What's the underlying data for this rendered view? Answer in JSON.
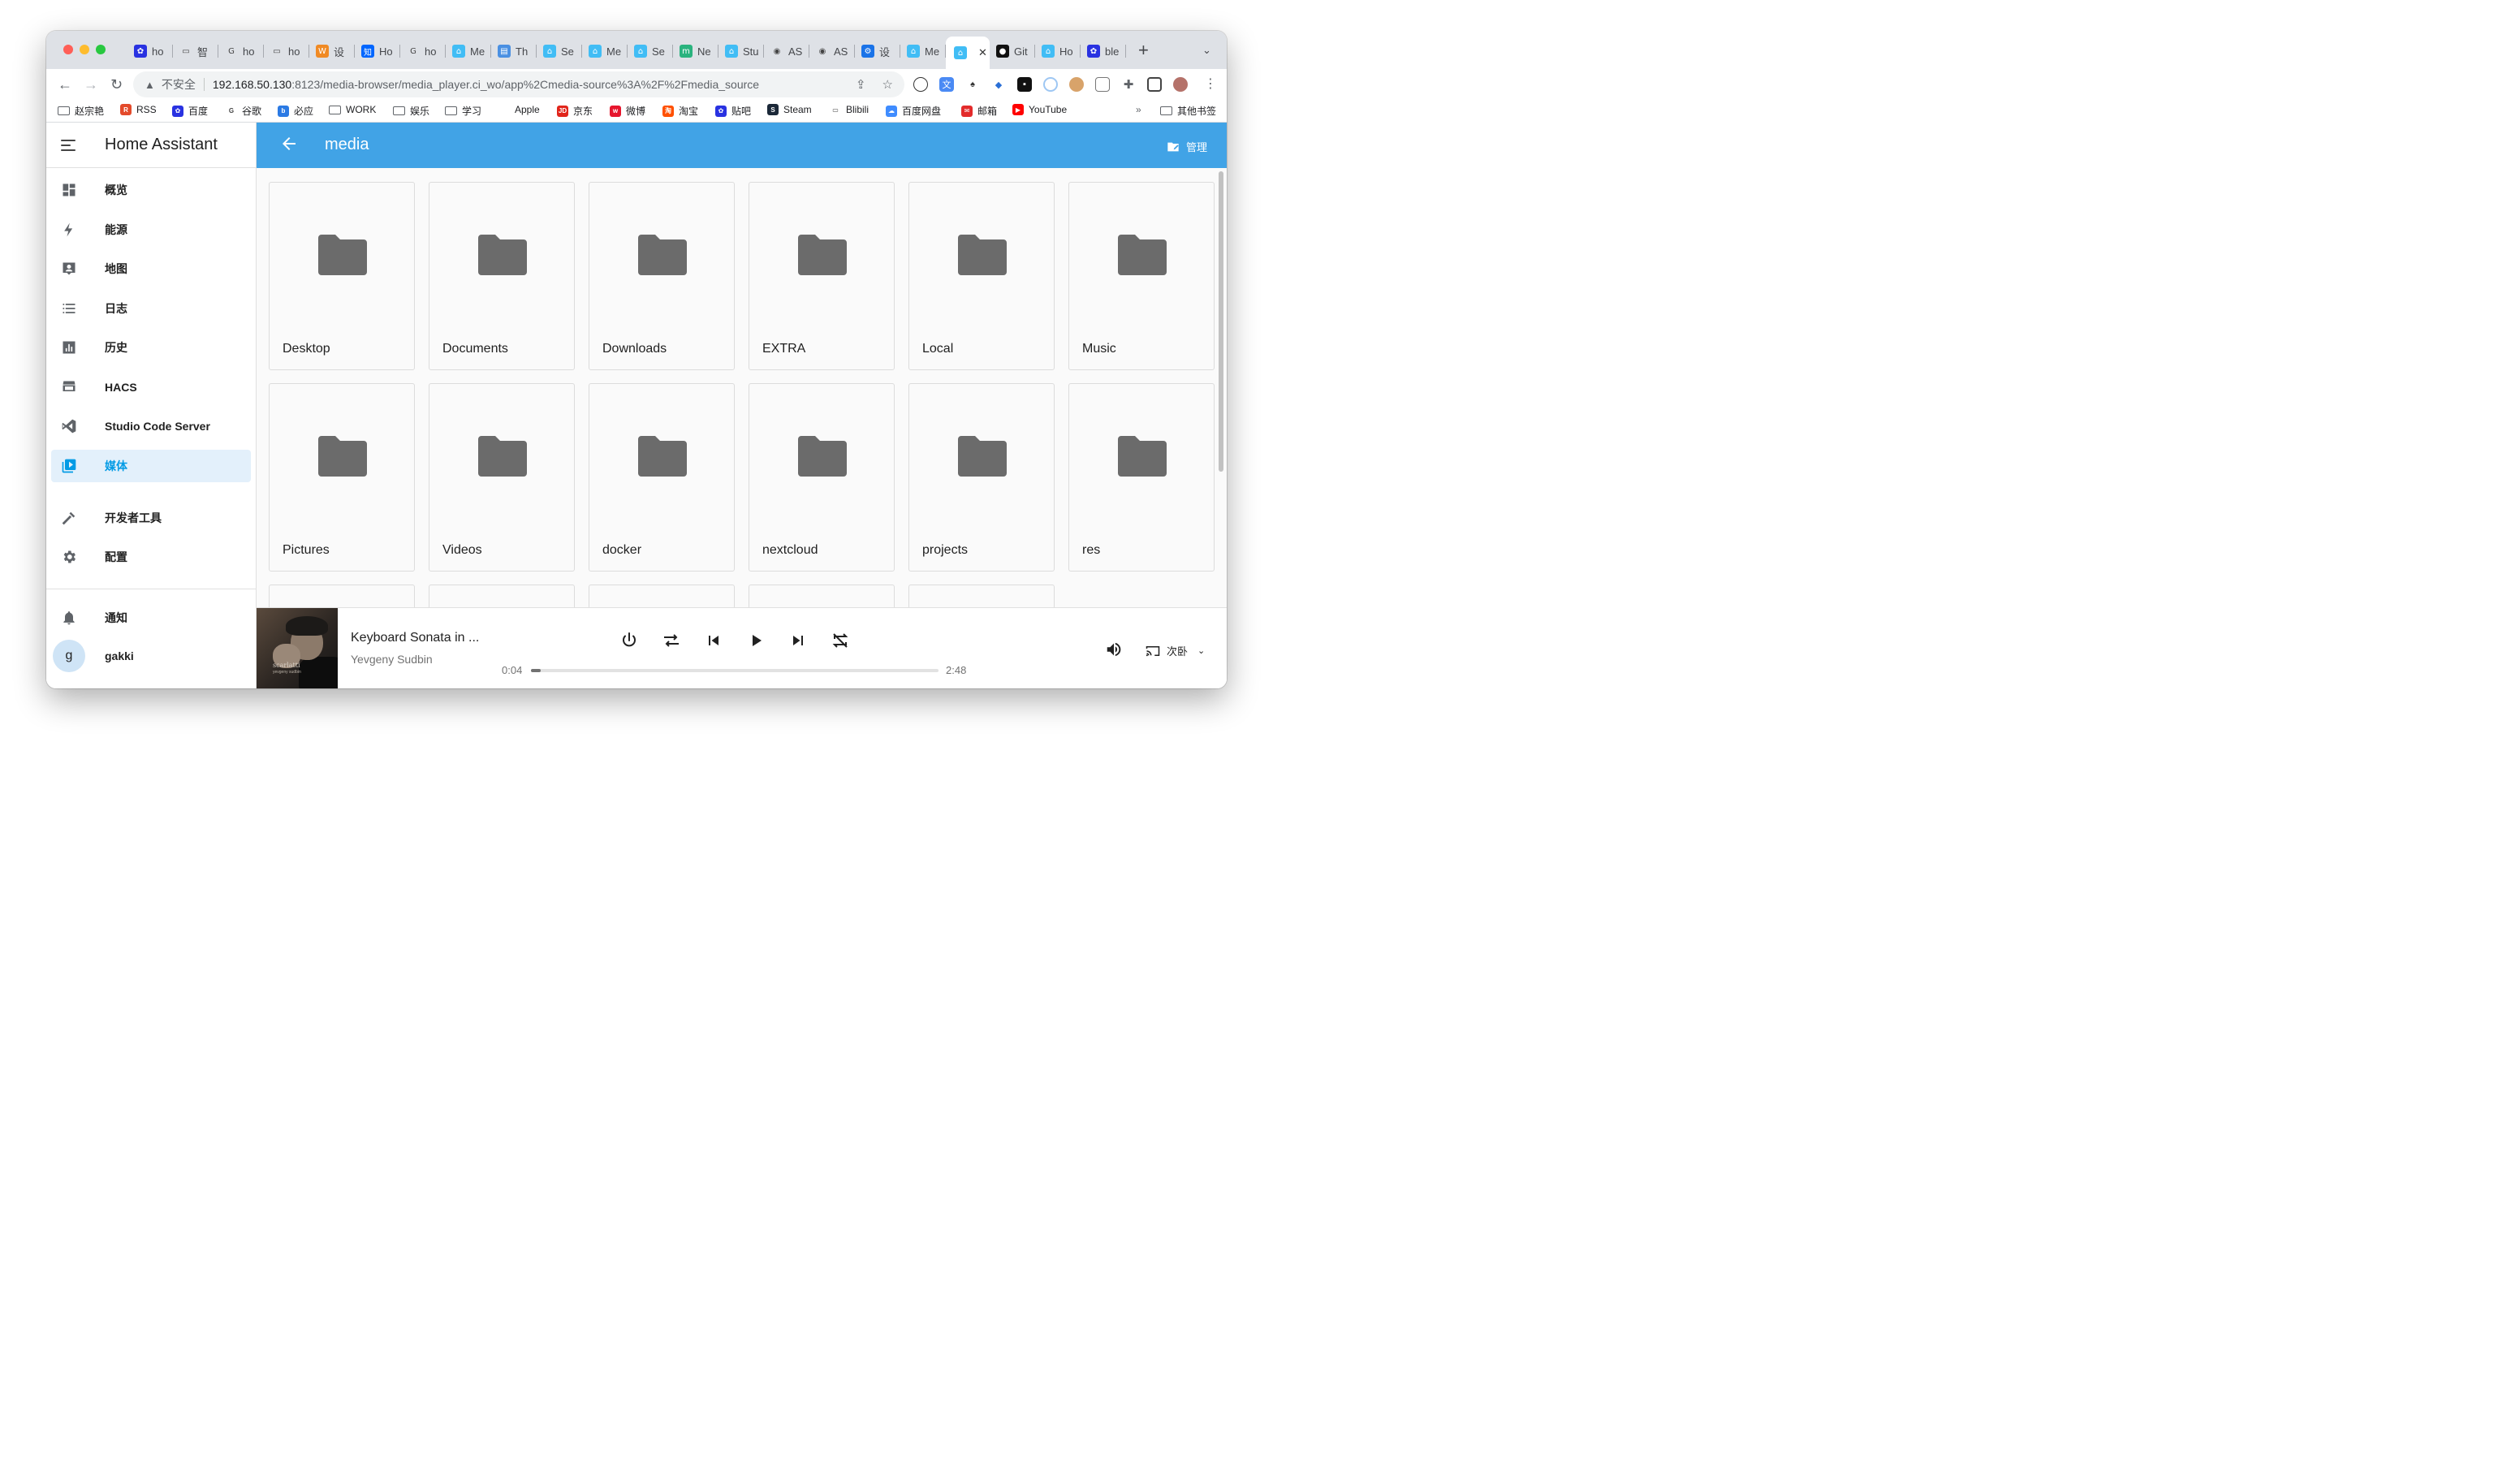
{
  "browser": {
    "tabs": [
      {
        "label": "ho",
        "icon": "baidu-paw-icon"
      },
      {
        "label": "智",
        "icon": "bilibili-icon"
      },
      {
        "label": "ho",
        "icon": "google-icon"
      },
      {
        "label": "ho",
        "icon": "bilibili-icon"
      },
      {
        "label": "设",
        "icon": "w-icon"
      },
      {
        "label": "Ho",
        "icon": "zhihu-icon"
      },
      {
        "label": "ho",
        "icon": "google-icon"
      },
      {
        "label": "Me",
        "icon": "home-assistant-icon"
      },
      {
        "label": "Th",
        "icon": "doc-icon"
      },
      {
        "label": "Se",
        "icon": "home-assistant-icon"
      },
      {
        "label": "Me",
        "icon": "home-assistant-icon"
      },
      {
        "label": "Se",
        "icon": "home-assistant-icon"
      },
      {
        "label": "Ne",
        "icon": "m-icon"
      },
      {
        "label": "Stu",
        "icon": "home-assistant-icon"
      },
      {
        "label": "AS",
        "icon": "radio-icon"
      },
      {
        "label": "AS",
        "icon": "radio-icon"
      },
      {
        "label": "设",
        "icon": "gear-icon"
      },
      {
        "label": "Me",
        "icon": "home-assistant-icon"
      },
      {
        "label": "",
        "icon": "home-assistant-icon",
        "active": true
      },
      {
        "label": "Git",
        "icon": "github-icon"
      },
      {
        "label": "Ho",
        "icon": "home-assistant-icon"
      },
      {
        "label": "ble",
        "icon": "baidu-paw-icon"
      }
    ],
    "new_tab": "+",
    "security_label": "不安全",
    "url_host": "192.168.50.130",
    "url_rest": ":8123/media-browser/media_player.ci_wo/app%2Cmedia-source%3A%2F%2Fmedia_source",
    "bookmarks": [
      {
        "label": "赵宗艳",
        "icon": "folder-icon"
      },
      {
        "label": "RSS",
        "icon": "rss-icon"
      },
      {
        "label": "百度",
        "icon": "baidu-paw-icon"
      },
      {
        "label": "谷歌",
        "icon": "google-icon"
      },
      {
        "label": "必应",
        "icon": "bing-icon"
      },
      {
        "label": "WORK",
        "icon": "folder-icon"
      },
      {
        "label": "娱乐",
        "icon": "folder-icon"
      },
      {
        "label": "学习",
        "icon": "folder-icon"
      },
      {
        "label": "Apple",
        "icon": "apple-icon"
      },
      {
        "label": "京东",
        "icon": "jd-icon"
      },
      {
        "label": "微博",
        "icon": "weibo-icon"
      },
      {
        "label": "淘宝",
        "icon": "taobao-icon"
      },
      {
        "label": "贴吧",
        "icon": "baidu-paw-icon"
      },
      {
        "label": "Steam",
        "icon": "steam-icon"
      },
      {
        "label": "Blibili",
        "icon": "bilibili-icon"
      },
      {
        "label": "百度网盘",
        "icon": "cloud-icon"
      },
      {
        "label": "邮箱",
        "icon": "mail-icon"
      },
      {
        "label": "YouTube",
        "icon": "youtube-icon"
      }
    ],
    "more_bookmarks": "»",
    "other_bookmarks": "其他书签"
  },
  "sidebar": {
    "title": "Home Assistant",
    "items": [
      {
        "label": "概览",
        "icon": "dashboard-icon"
      },
      {
        "label": "能源",
        "icon": "lightning-icon"
      },
      {
        "label": "地图",
        "icon": "map-account-icon"
      },
      {
        "label": "日志",
        "icon": "list-icon"
      },
      {
        "label": "历史",
        "icon": "chart-icon"
      },
      {
        "label": "HACS",
        "icon": "hacs-store-icon"
      },
      {
        "label": "Studio Code Server",
        "icon": "vscode-icon"
      },
      {
        "label": "媒体",
        "icon": "media-icon",
        "selected": true
      },
      {
        "label": "开发者工具",
        "icon": "hammer-icon"
      },
      {
        "label": "配置",
        "icon": "cog-icon"
      }
    ],
    "notifications": "通知",
    "user": {
      "name": "gakki",
      "initial": "g"
    }
  },
  "header": {
    "title": "media",
    "manage_label": "管理"
  },
  "folders": [
    "Desktop",
    "Documents",
    "Downloads",
    "EXTRA",
    "Local",
    "Music",
    "Pictures",
    "Videos",
    "docker",
    "nextcloud",
    "projects",
    "res"
  ],
  "player": {
    "track": "Keyboard Sonata in ...",
    "artist": "Yevgeny Sudbin",
    "elapsed": "0:04",
    "duration": "2:48",
    "progress": 0.024,
    "album_text": "scarlatti",
    "album_subtext": "yevgeny sudbin",
    "output_device": "次卧"
  },
  "colors": {
    "accent": "#41a3e6",
    "selected_bg": "#e3f0fb",
    "selected_text": "#039be5",
    "folder_icon": "#6b6b6b"
  }
}
